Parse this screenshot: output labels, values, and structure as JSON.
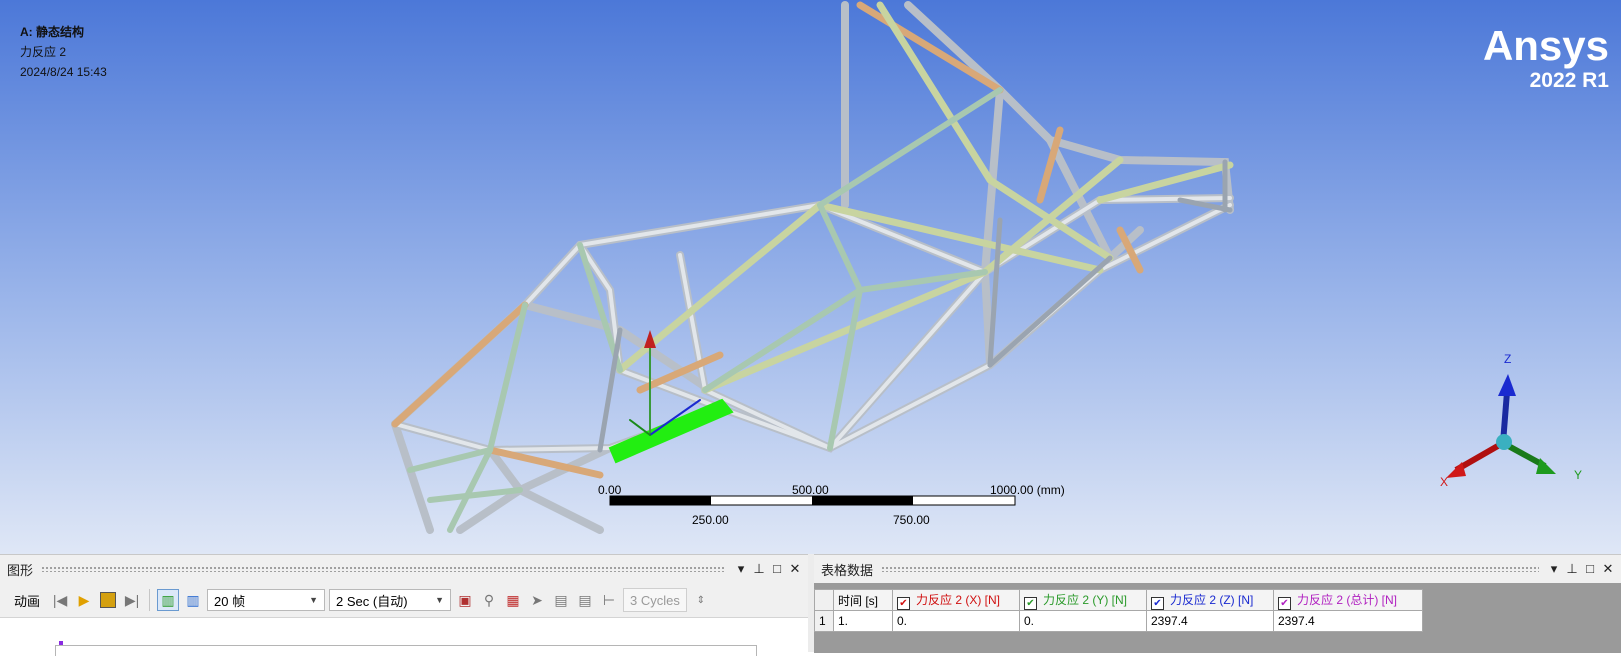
{
  "viewport": {
    "analysis_title": "A: 静态结构",
    "result_name": "力反应 2",
    "timestamp": "2024/8/24 15:43",
    "brand": "Ansys",
    "version": "2022 R1",
    "scale_bar": {
      "labels_top": [
        "0.00",
        "500.00",
        "1000.00 (mm)"
      ],
      "labels_bottom": [
        "250.00",
        "750.00"
      ]
    },
    "triad": {
      "z": "Z",
      "x": "X",
      "y": "Y"
    },
    "colors": {
      "bg_top": "#4c78d8",
      "bg_bottom": "#dfe7f6",
      "highlight": "#22ee11"
    }
  },
  "graph_panel": {
    "title": "图形",
    "header_buttons": [
      "▾",
      "ᵖ",
      "□",
      "✕"
    ],
    "toolbar": {
      "animation_label": "动画",
      "frames": "20 帧",
      "duration": "2 Sec (自动)",
      "cycles": "3 Cycles"
    }
  },
  "table_panel": {
    "title": "表格数据",
    "header_buttons": [
      "▾",
      "ᵖ",
      "□",
      "✕"
    ],
    "columns": [
      "时间 [s]",
      "力反应 2 (X) [N]",
      "力反应 2 (Y) [N]",
      "力反应 2 (Z) [N]",
      "力反应 2 (总计) [N]"
    ],
    "column_colors": [
      "#000000",
      "#d01010",
      "#2a9a2a",
      "#1a2ad0",
      "#b020c0"
    ],
    "rows": [
      {
        "num": "1",
        "cells": [
          "1.",
          "0.",
          "0.",
          "2397.4",
          "2397.4"
        ]
      }
    ]
  }
}
